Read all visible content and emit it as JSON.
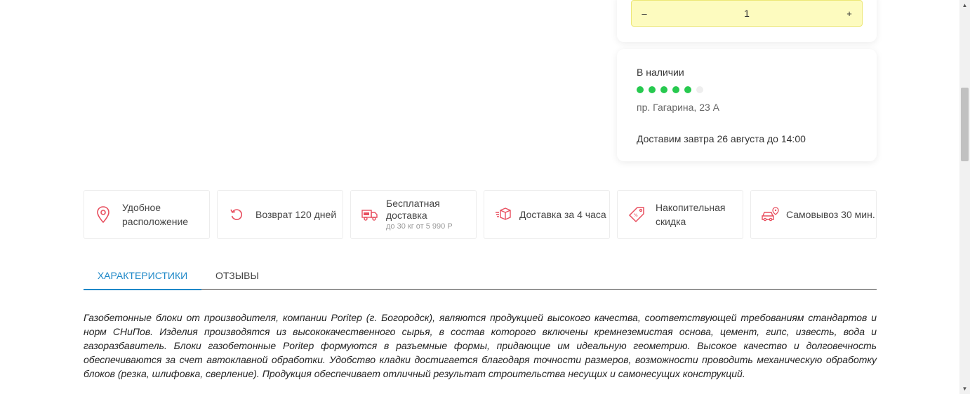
{
  "quantity": {
    "minus_label": "–",
    "value": "1",
    "plus_label": "+"
  },
  "stock": {
    "status": "В наличии",
    "level": 5,
    "level_max": 6,
    "address": "пр. Гагарина, 23 А",
    "delivery": "Доставим завтра 26 августа до 14:00",
    "color_filled": "#27c94f",
    "color_empty": "#eeeeee"
  },
  "features": [
    {
      "icon": "location-pin-icon",
      "line1": "Удобное",
      "line2": "расположение"
    },
    {
      "icon": "return-icon",
      "line1": "Возврат 120 дней"
    },
    {
      "icon": "free-delivery-truck-icon",
      "line1": "Бесплатная",
      "line2": "доставка",
      "sub": "до 30 кг от 5 990 Р"
    },
    {
      "icon": "box-delivery-icon",
      "line1": "Доставка за 4 часа"
    },
    {
      "icon": "discount-tag-icon",
      "line1": "Накопительная",
      "line2": "скидка"
    },
    {
      "icon": "car-pickup-icon",
      "line1": "Самовывоз 30 мин."
    }
  ],
  "tabs": [
    {
      "label": "Характеристики",
      "active": true
    },
    {
      "label": "Отзывы",
      "active": false
    }
  ],
  "description": "Газобетонные блоки от производителя, компании Poritep (г. Богородск), являются продукцией высокого качества, соответствующей требованиям стандартов и норм СНиПов. Изделия производятся из высококачественного сырья, в состав которого включены кремнеземистая основа, цемент, гипс, известь, вода и газоразбавитель. Блоки газобетонные Poritep формуются в разъемные формы, придающие им идеальную геометрию. Высокое качество и долговечность обеспечиваются за счет автоклавной обработки. Удобство кладки достигается благодаря точности размеров, возможности проводить механическую обработку блоков (резка, шлифовка, сверление). Продукция обеспечивает отличный результат строительства несущих и самонесущих конструкций.",
  "colors": {
    "accent": "#1e88c8",
    "icon_red": "#e84e5e",
    "stepper_bg": "#fdfbbf"
  }
}
